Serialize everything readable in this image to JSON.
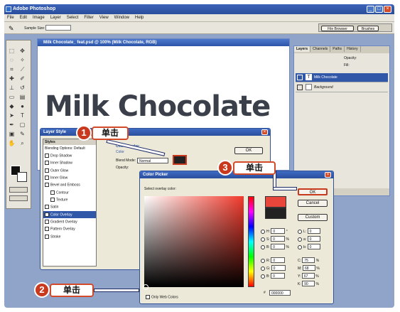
{
  "app": {
    "title": "Adobe Photoshop"
  },
  "menu": [
    "File",
    "Edit",
    "Image",
    "Layer",
    "Select",
    "Filter",
    "View",
    "Window",
    "Help"
  ],
  "options": {
    "sample_label": "Sample Size:"
  },
  "palette_well": {
    "file_browser": "File Browser",
    "brushes": "Brushes"
  },
  "document": {
    "title": "Milk Chocolate_ feat.psd @ 100% (Milk Chocolate, RGB)",
    "canvas_text": "Milk Chocolate"
  },
  "layers_panel": {
    "tabs": [
      "Layers",
      "Channels",
      "Paths",
      "History"
    ],
    "opacity_label": "Opacity:",
    "fill_label": "Fill:",
    "layers": [
      "Milk Chocolate",
      "Background"
    ]
  },
  "layer_style": {
    "title": "Layer Style",
    "styles_header": "Styles",
    "items": [
      "Blending Options: Default",
      "Drop Shadow",
      "Inner Shadow",
      "Outer Glow",
      "Inner Glow",
      "Bevel and Emboss",
      "Contour",
      "Texture",
      "Satin",
      "Color Overlay",
      "Gradient Overlay",
      "Pattern Overlay",
      "Stroke"
    ],
    "section": "Color Overlay",
    "subsection": "Color",
    "blend_label": "Blend Mode:",
    "blend_value": "Normal",
    "opacity_label": "Opacity:",
    "ok": "OK"
  },
  "color_picker": {
    "title": "Color Picker",
    "subtitle": "Select overlay color:",
    "ok": "OK",
    "cancel": "Cancel",
    "custom": "Custom",
    "fields": [
      {
        "label": "H:",
        "value": "0",
        "unit": "°"
      },
      {
        "label": "S:",
        "value": "0",
        "unit": "%"
      },
      {
        "label": "B:",
        "value": "0",
        "unit": "%"
      },
      {
        "label": "R:",
        "value": "0",
        "unit": ""
      },
      {
        "label": "G:",
        "value": "0",
        "unit": ""
      },
      {
        "label": "B:",
        "value": "0",
        "unit": ""
      }
    ],
    "lab_fields": [
      {
        "label": "L:",
        "value": "0"
      },
      {
        "label": "a:",
        "value": "0"
      },
      {
        "label": "b:",
        "value": "0"
      }
    ],
    "cmyk_fields": [
      {
        "label": "C:",
        "value": "75"
      },
      {
        "label": "M:",
        "value": "68"
      },
      {
        "label": "Y:",
        "value": "67"
      },
      {
        "label": "K:",
        "value": "90"
      }
    ],
    "hex_label": "#",
    "hex_value": "000000",
    "web_colors": "Only Web Colors",
    "new_color": "#e8463a",
    "old_color": "#222222"
  },
  "callouts": {
    "step1": {
      "number": "1",
      "text": "单击"
    },
    "step2": {
      "number": "2",
      "text": "单击"
    },
    "step3": {
      "number": "3",
      "text": "单击"
    }
  },
  "colors": {
    "accent": "#c8391e",
    "titlebar": "#2a4e9c"
  }
}
